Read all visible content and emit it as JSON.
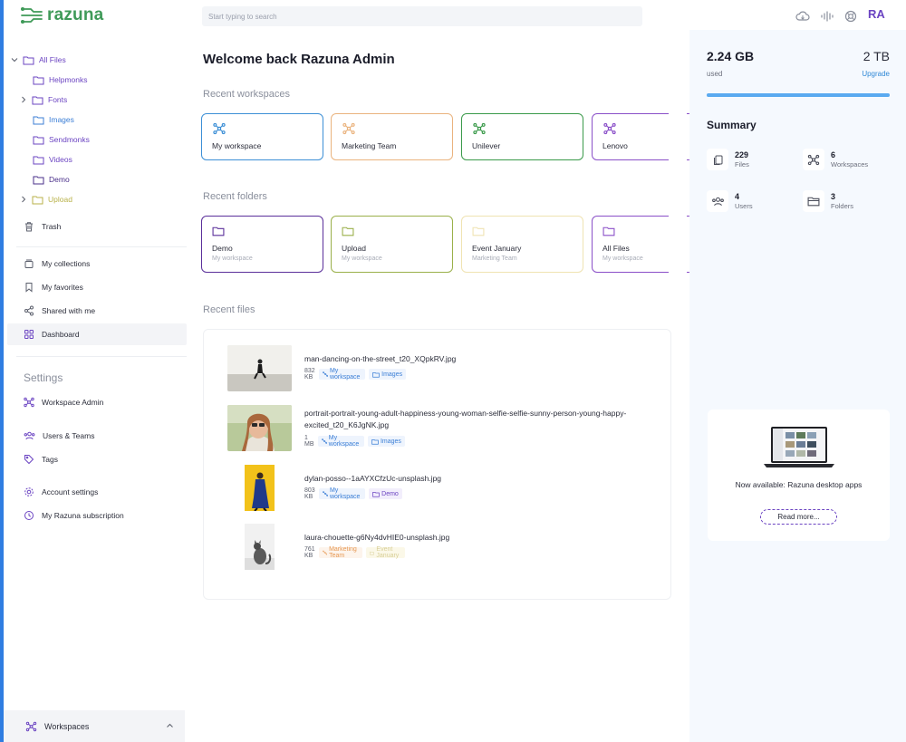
{
  "app": {
    "logo_text": "razuna"
  },
  "header": {
    "search_placeholder": "Start typing to search",
    "avatar_initials": "RA"
  },
  "sidebar": {
    "tree": [
      {
        "label": "All Files",
        "color": "#6b44c2"
      },
      {
        "label": "Helpmonks",
        "color": "#6b44c2"
      },
      {
        "label": "Fonts",
        "color": "#6b44c2"
      },
      {
        "label": "Images",
        "color": "#3c7fd6"
      },
      {
        "label": "Sendmonks",
        "color": "#6b44c2"
      },
      {
        "label": "Videos",
        "color": "#6b44c2"
      },
      {
        "label": "Demo",
        "color": "#4a2f8a"
      },
      {
        "label": "Upload",
        "color": "#b9b24a"
      }
    ],
    "trash": "Trash",
    "nav": {
      "collections": "My collections",
      "favorites": "My favorites",
      "shared": "Shared with me",
      "dashboard": "Dashboard"
    },
    "settings_heading": "Settings",
    "settings": {
      "workspace_admin": "Workspace Admin",
      "users_teams": "Users & Teams",
      "tags": "Tags",
      "account": "Account settings",
      "subscription": "My Razuna subscription"
    },
    "workspaces_bar": "Workspaces"
  },
  "main": {
    "title": "Welcome back Razuna Admin",
    "recent_workspaces_title": "Recent workspaces",
    "workspaces": [
      {
        "label": "My workspace",
        "color": "#3c8fd6"
      },
      {
        "label": "Marketing Team",
        "color": "#eab37e"
      },
      {
        "label": "Unilever",
        "color": "#3a9a4a"
      },
      {
        "label": "Lenovo",
        "color": "#8a4fc8"
      }
    ],
    "recent_folders_title": "Recent folders",
    "folders": [
      {
        "label": "Demo",
        "sub": "My workspace",
        "color": "#5a2f9a"
      },
      {
        "label": "Upload",
        "sub": "My workspace",
        "color": "#9ab04a"
      },
      {
        "label": "Event January",
        "sub": "Marketing Team",
        "color": "#efe3b2"
      },
      {
        "label": "All Files",
        "sub": "My workspace",
        "color": "#8a4fc8"
      }
    ],
    "recent_files_title": "Recent files",
    "files": [
      {
        "name": "man-dancing-on-the-street_t20_XQpkRV.jpg",
        "size": "832 KB",
        "workspace": "My workspace",
        "folder": "Images"
      },
      {
        "name": "portrait-portrait-young-adult-happiness-young-woman-selfie-selfie-sunny-person-young-happy-excited_t20_K6JgNK.jpg",
        "size": "1 MB",
        "workspace": "My workspace",
        "folder": "Images"
      },
      {
        "name": "dylan-posso--1aAYXCfzUc-unsplash.jpg",
        "size": "803 KB",
        "workspace": "My workspace",
        "folder": "Demo"
      },
      {
        "name": "laura-chouette-g6Ny4dvHIE0-unsplash.jpg",
        "size": "761 KB",
        "workspace": "Marketing Team",
        "folder": "Event January"
      }
    ]
  },
  "storage": {
    "used": "2.24 GB",
    "used_label": "used",
    "total": "2 TB",
    "upgrade": "Upgrade",
    "used_percent": 100
  },
  "summary": {
    "title": "Summary",
    "files": {
      "count": "229",
      "label": "Files"
    },
    "workspaces": {
      "count": "6",
      "label": "Workspaces"
    },
    "users": {
      "count": "4",
      "label": "Users"
    },
    "folders": {
      "count": "3",
      "label": "Folders"
    }
  },
  "promo": {
    "text": "Now available: Razuna desktop apps",
    "button": "Read more..."
  }
}
